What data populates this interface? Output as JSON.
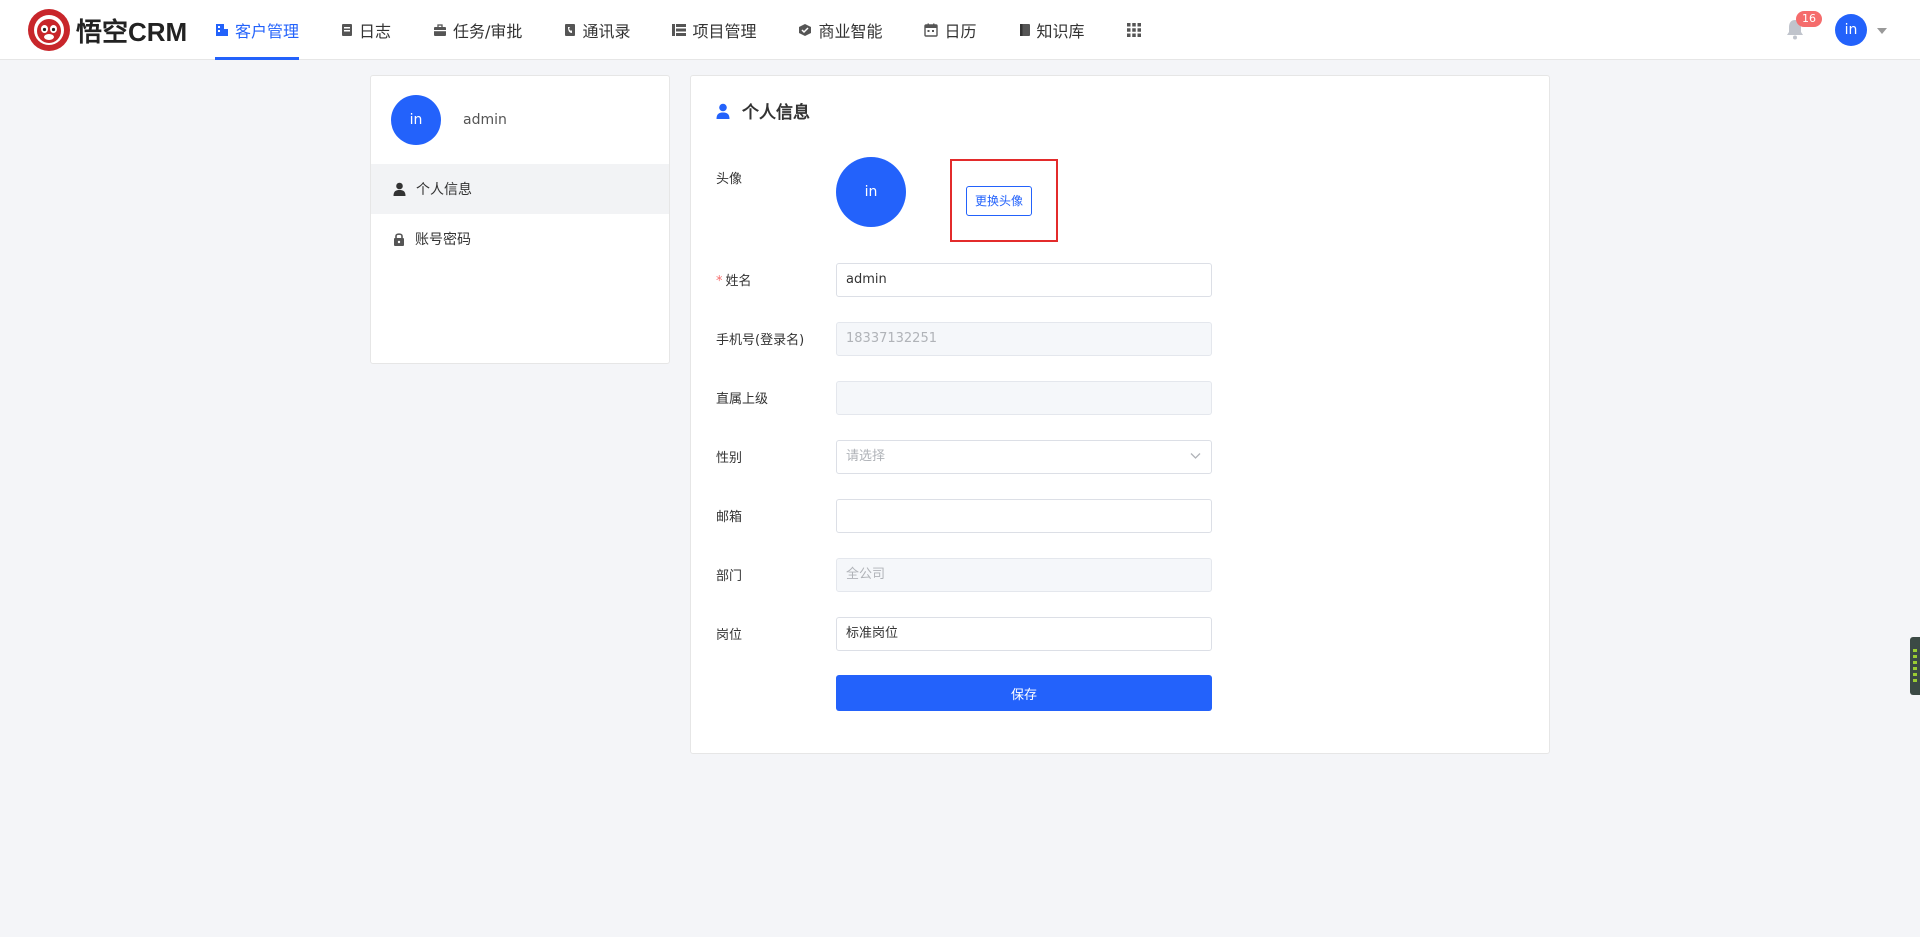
{
  "app": {
    "logo_text": "悟空CRM"
  },
  "nav": {
    "items": [
      {
        "label": "客户管理",
        "icon": "building-icon",
        "active": true
      },
      {
        "label": "日志",
        "icon": "note-icon"
      },
      {
        "label": "任务/审批",
        "icon": "briefcase-icon"
      },
      {
        "label": "通讯录",
        "icon": "phone-icon"
      },
      {
        "label": "项目管理",
        "icon": "list-icon"
      },
      {
        "label": "商业智能",
        "icon": "cube-icon"
      },
      {
        "label": "日历",
        "icon": "calendar-icon"
      },
      {
        "label": "知识库",
        "icon": "book-icon"
      }
    ],
    "apps_icon": "grid-icon"
  },
  "header": {
    "notification_count": "16",
    "avatar_text": "in"
  },
  "sidebar": {
    "avatar_text": "in",
    "username": "admin",
    "items": [
      {
        "label": "个人信息",
        "icon": "user-icon",
        "active": true
      },
      {
        "label": "账号密码",
        "icon": "lock-icon"
      }
    ]
  },
  "profile": {
    "title": "个人信息",
    "avatar_label": "头像",
    "avatar_text": "in",
    "change_avatar_button": "更换头像",
    "name_label": "姓名",
    "name_value": "admin",
    "phone_label": "手机号(登录名)",
    "phone_value": "18337132251",
    "supervisor_label": "直属上级",
    "supervisor_value": "",
    "gender_label": "性别",
    "gender_placeholder": "请选择",
    "email_label": "邮箱",
    "email_value": "",
    "department_label": "部门",
    "department_value": "全公司",
    "position_label": "岗位",
    "position_value": "标准岗位",
    "save_button": "保存"
  },
  "colors": {
    "primary": "#2362fb",
    "badge": "#f56c6c",
    "highlight": "#e32b2b"
  }
}
